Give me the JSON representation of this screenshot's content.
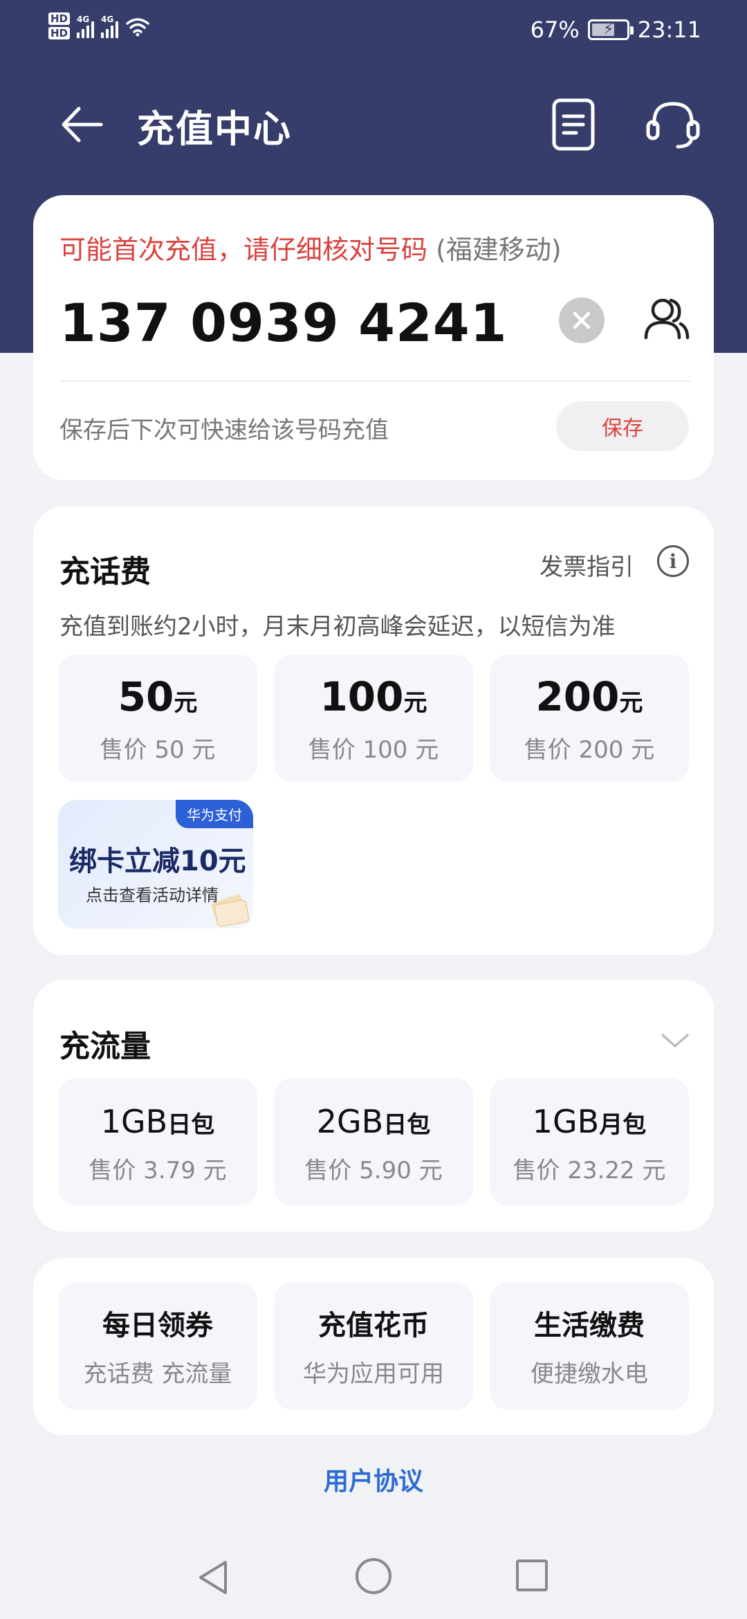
{
  "status_bar": {
    "hd1": "HD",
    "hd2": "HD",
    "net1": "4G",
    "net2": "4G",
    "battery": "67%",
    "battery_level": 0.67,
    "time": "23:11"
  },
  "header": {
    "title": "充值中心",
    "back_icon": "back-arrow-icon",
    "bill_icon": "bill-list-icon",
    "service_icon": "headset-icon"
  },
  "phone_card": {
    "warning": "可能首次充值，请仔细核对号码",
    "operator": "(福建移动)",
    "number": "137 0939 4241",
    "save_hint": "保存后下次可快速给该号码充值",
    "save_label": "保存"
  },
  "topup": {
    "title": "充话费",
    "invoice_label": "发票指引",
    "note": "充值到账约2小时，月末月初高峰会延迟，以短信为准",
    "options": [
      {
        "amount": "50",
        "unit": "元",
        "price": "售价 50 元"
      },
      {
        "amount": "100",
        "unit": "元",
        "price": "售价 100 元"
      },
      {
        "amount": "200",
        "unit": "元",
        "price": "售价 200 元"
      }
    ],
    "promo": {
      "badge": "华为支付",
      "title": "绑卡立减10元",
      "subtitle": "点击查看活动详情"
    }
  },
  "data_plan": {
    "title": "充流量",
    "options": [
      {
        "amount": "1GB",
        "unit": "日包",
        "price": "售价 3.79 元"
      },
      {
        "amount": "2GB",
        "unit": "日包",
        "price": "售价 5.90 元"
      },
      {
        "amount": "1GB",
        "unit": "月包",
        "price": "售价 23.22 元"
      }
    ]
  },
  "services": [
    {
      "title": "每日领券",
      "subtitle": "充话费 充流量"
    },
    {
      "title": "充值花币",
      "subtitle": "华为应用可用"
    },
    {
      "title": "生活缴费",
      "subtitle": "便捷缴水电"
    }
  ],
  "footer": {
    "agreement": "用户协议"
  },
  "colors": {
    "header_bg": "#363d6a",
    "warning": "#d9433f",
    "link": "#2e6bd2",
    "page_bg": "#f1f2f5"
  }
}
